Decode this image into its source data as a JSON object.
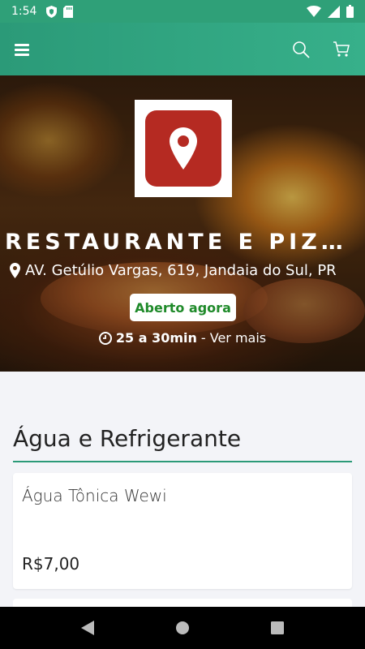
{
  "status_bar": {
    "time": "1:54",
    "icons": [
      "shield-icon",
      "sd-card-icon",
      "wifi-icon",
      "signal-icon",
      "battery-icon"
    ]
  },
  "app_bar": {
    "icons": [
      "menu-icon",
      "search-icon",
      "cart-icon"
    ]
  },
  "restaurant": {
    "name": "RESTAURANTE E PIZZA...",
    "address": "AV. Getúlio Vargas, 619, Jandaia do Sul, PR",
    "status": "Aberto agora",
    "delivery_time": "25 a 30min",
    "see_more": " - Ver mais"
  },
  "menu": {
    "section_title": "Água e Refrigerante",
    "items": [
      {
        "name": "Água Tônica Wewi",
        "price": "R$7,00"
      }
    ]
  },
  "colors": {
    "primary": "#2b9a78",
    "open_green": "#1f8a2a",
    "logo_red": "#b52a22"
  }
}
